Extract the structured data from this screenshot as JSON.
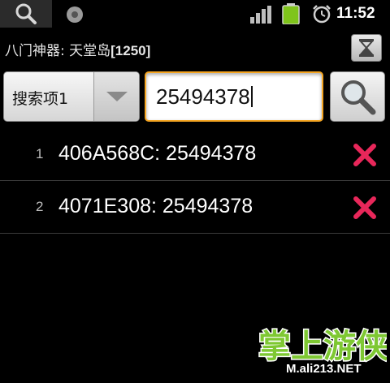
{
  "status_bar": {
    "time": "11:52",
    "icons": [
      "search-icon",
      "notification-icon",
      "signal-icon",
      "battery-icon",
      "alarm-icon"
    ],
    "battery_color": "#7fc41b"
  },
  "app": {
    "title": "八门神器: 天堂岛",
    "result_count": "[1250]"
  },
  "search": {
    "type_label": "搜索项1",
    "value": "25494378",
    "focus_color": "#f5a623"
  },
  "results": [
    {
      "index": "1",
      "entry": "406A568C: 25494378"
    },
    {
      "index": "2",
      "entry": "4071E308: 25494378"
    }
  ],
  "colors": {
    "delete": "#e8275a",
    "background": "#000000"
  },
  "watermark": {
    "logo_text": "掌上游侠",
    "site": "M.ali213.NET"
  }
}
